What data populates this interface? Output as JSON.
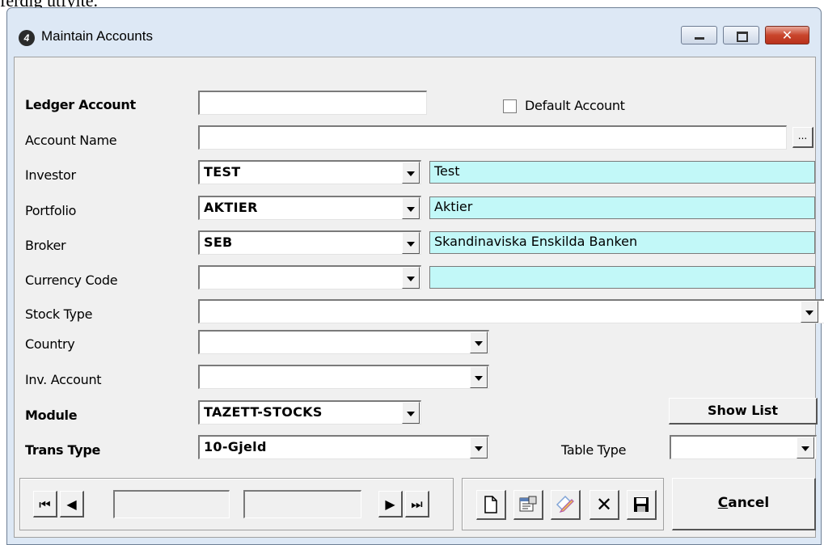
{
  "background_text": "ferdig utfylte.",
  "window": {
    "title": "Maintain Accounts",
    "app_icon": "4",
    "controls": {
      "minimize": "minimize-icon",
      "maximize": "maximize-icon",
      "close": "✕"
    }
  },
  "form": {
    "ledger_account": {
      "label": "Ledger Account",
      "value": ""
    },
    "default_account": {
      "label": "Default Account",
      "checked": false
    },
    "account_name": {
      "label": "Account Name",
      "value": "",
      "browse_label": "..."
    },
    "investor": {
      "label": "Investor",
      "code": "TEST",
      "description": "Test"
    },
    "portfolio": {
      "label": "Portfolio",
      "code": "AKTIER",
      "description": "Aktier"
    },
    "broker": {
      "label": "Broker",
      "code": "SEB",
      "description": "Skandinaviska Enskilda Banken"
    },
    "currency_code": {
      "label": "Currency Code",
      "code": "",
      "description": ""
    },
    "stock_type": {
      "label": "Stock Type",
      "value": ""
    },
    "country": {
      "label": "Country",
      "value": ""
    },
    "inv_account": {
      "label": "Inv. Account",
      "value": ""
    },
    "module": {
      "label": "Module",
      "value": "TAZETT-STOCKS"
    },
    "show_list": {
      "label": "Show List"
    },
    "trans_type": {
      "label": "Trans Type",
      "value": "10-Gjeld"
    },
    "table_type": {
      "label": "Table Type",
      "value": ""
    }
  },
  "navigation": {
    "first": "⏮",
    "prev": "◀",
    "next": "▶",
    "last": "⏭",
    "record_field_1": "",
    "record_field_2": ""
  },
  "toolbar": {
    "new_icon": "new-document-icon",
    "props_icon": "properties-icon",
    "edit_icon": "edit-pencil-icon",
    "delete_symbol": "✕",
    "save_icon": "save-disk-icon",
    "cancel_label": "Cancel"
  },
  "colors": {
    "lookup_bg": "#c2f8f8",
    "window_frame": "#dde8f5",
    "client_bg": "#f0f0f0",
    "close_button": "#c9452c"
  }
}
